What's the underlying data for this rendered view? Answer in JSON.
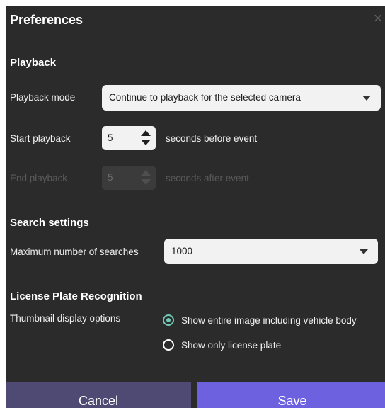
{
  "dialog": {
    "title": "Preferences",
    "close_icon": "×"
  },
  "playback": {
    "section_title": "Playback",
    "mode_label": "Playback mode",
    "mode_value": "Continue to playback for the selected camera",
    "start_label": "Start playback",
    "start_value": "5",
    "start_suffix": "seconds before event",
    "end_label": "End playback",
    "end_value": "5",
    "end_suffix": "seconds after event"
  },
  "search": {
    "section_title": "Search settings",
    "max_label": "Maximum number of searches",
    "max_value": "1000"
  },
  "lpr": {
    "section_title": "License Plate Recognition",
    "thumb_label": "Thumbnail display options",
    "options": [
      {
        "label": "Show entire image including vehicle body",
        "checked": true
      },
      {
        "label": "Show only license plate",
        "checked": false
      }
    ]
  },
  "footer": {
    "cancel_label": "Cancel",
    "save_label": "Save"
  },
  "colors": {
    "background": "#2b2b2b",
    "accent_radio": "#6fc9b5",
    "save_button": "#6e61e0",
    "cancel_button": "#4e4a73"
  }
}
